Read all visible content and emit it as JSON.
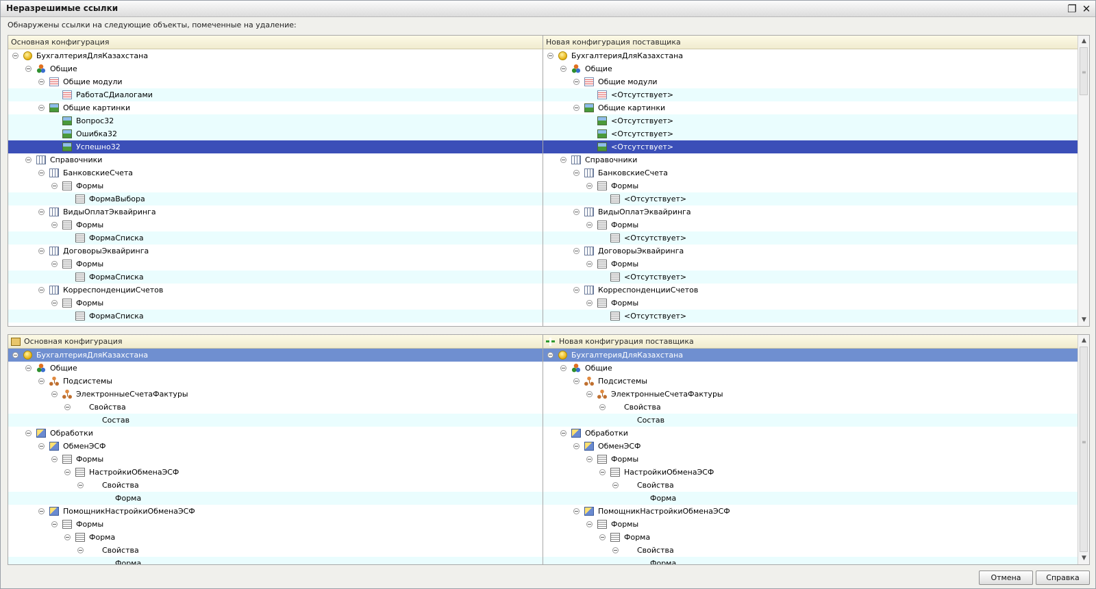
{
  "window": {
    "title": "Неразрешимые ссылки",
    "restore_icon": "restore-window-icon",
    "close_icon": "close-icon"
  },
  "description": "Обнаружены ссылки на следующие объекты, помеченные на удаление:",
  "top_panel": {
    "left_header": "Основная конфигурация",
    "right_header": "Новая конфигурация поставщика",
    "rows": [
      {
        "level": 0,
        "icon": "config",
        "left": "БухгалтерияДляКазахстана",
        "right": "БухгалтерияДляКазахстана",
        "expander": true,
        "alt": false,
        "selected": false
      },
      {
        "level": 1,
        "icon": "common",
        "left": "Общие",
        "right": "Общие",
        "expander": true,
        "alt": false,
        "selected": false
      },
      {
        "level": 2,
        "icon": "module",
        "left": "Общие модули",
        "right": "Общие модули",
        "expander": true,
        "alt": false,
        "selected": false
      },
      {
        "level": 3,
        "icon": "module",
        "left": "РаботаСДиалогами",
        "right": "<Отсутствует>",
        "expander": false,
        "alt": true,
        "selected": false
      },
      {
        "level": 2,
        "icon": "picture",
        "left": "Общие картинки",
        "right": "Общие картинки",
        "expander": true,
        "alt": false,
        "selected": false
      },
      {
        "level": 3,
        "icon": "picture",
        "left": "Вопрос32",
        "right": "<Отсутствует>",
        "expander": false,
        "alt": true,
        "selected": false
      },
      {
        "level": 3,
        "icon": "picture",
        "left": "Ошибка32",
        "right": "<Отсутствует>",
        "expander": false,
        "alt": true,
        "selected": false
      },
      {
        "level": 3,
        "icon": "picture",
        "left": "Успешно32",
        "right": "<Отсутствует>",
        "expander": false,
        "alt": false,
        "selected": true
      },
      {
        "level": 1,
        "icon": "catalog",
        "left": "Справочники",
        "right": "Справочники",
        "expander": true,
        "alt": false,
        "selected": false
      },
      {
        "level": 2,
        "icon": "catalog",
        "left": "БанковскиеСчета",
        "right": "БанковскиеСчета",
        "expander": true,
        "alt": false,
        "selected": false
      },
      {
        "level": 3,
        "icon": "form",
        "left": "Формы",
        "right": "Формы",
        "expander": true,
        "alt": false,
        "selected": false
      },
      {
        "level": 4,
        "icon": "form",
        "left": "ФормаВыбора",
        "right": "<Отсутствует>",
        "expander": false,
        "alt": true,
        "selected": false
      },
      {
        "level": 2,
        "icon": "catalog",
        "left": "ВидыОплатЭквайринга",
        "right": "ВидыОплатЭквайринга",
        "expander": true,
        "alt": false,
        "selected": false
      },
      {
        "level": 3,
        "icon": "form",
        "left": "Формы",
        "right": "Формы",
        "expander": true,
        "alt": false,
        "selected": false
      },
      {
        "level": 4,
        "icon": "form",
        "left": "ФормаСписка",
        "right": "<Отсутствует>",
        "expander": false,
        "alt": true,
        "selected": false
      },
      {
        "level": 2,
        "icon": "catalog",
        "left": "ДоговорыЭквайринга",
        "right": "ДоговорыЭквайринга",
        "expander": true,
        "alt": false,
        "selected": false
      },
      {
        "level": 3,
        "icon": "form",
        "left": "Формы",
        "right": "Формы",
        "expander": true,
        "alt": false,
        "selected": false
      },
      {
        "level": 4,
        "icon": "form",
        "left": "ФормаСписка",
        "right": "<Отсутствует>",
        "expander": false,
        "alt": true,
        "selected": false
      },
      {
        "level": 2,
        "icon": "catalog",
        "left": "КорреспонденцииСчетов",
        "right": "КорреспонденцииСчетов",
        "expander": true,
        "alt": false,
        "selected": false
      },
      {
        "level": 3,
        "icon": "form",
        "left": "Формы",
        "right": "Формы",
        "expander": true,
        "alt": false,
        "selected": false
      },
      {
        "level": 4,
        "icon": "form",
        "left": "ФормаСписка",
        "right": "<Отсутствует>",
        "expander": false,
        "alt": true,
        "selected": false
      }
    ]
  },
  "bottom_panel": {
    "left_header": "Основная конфигурация",
    "right_header": "Новая конфигурация поставщика",
    "rows": [
      {
        "level": 0,
        "icon": "config",
        "left": "БухгалтерияДляКазахстана",
        "right": "БухгалтерияДляКазахстана",
        "expander": true,
        "alt": false,
        "selected": true
      },
      {
        "level": 1,
        "icon": "common",
        "left": "Общие",
        "right": "Общие",
        "expander": true,
        "alt": false,
        "selected": false
      },
      {
        "level": 2,
        "icon": "subsystem",
        "left": "Подсистемы",
        "right": "Подсистемы",
        "expander": true,
        "alt": false,
        "selected": false
      },
      {
        "level": 3,
        "icon": "subsystem",
        "left": "ЭлектронныеСчетаФактуры",
        "right": "ЭлектронныеСчетаФактуры",
        "expander": true,
        "alt": false,
        "selected": false
      },
      {
        "level": 4,
        "icon": "none",
        "left": "Свойства",
        "right": "Свойства",
        "expander": true,
        "alt": false,
        "selected": false
      },
      {
        "level": 5,
        "icon": "none",
        "left": "Состав",
        "right": "Состав",
        "expander": false,
        "alt": true,
        "selected": false
      },
      {
        "level": 1,
        "icon": "processing",
        "left": "Обработки",
        "right": "Обработки",
        "expander": true,
        "alt": false,
        "selected": false
      },
      {
        "level": 2,
        "icon": "processing",
        "left": "ОбменЭСФ",
        "right": "ОбменЭСФ",
        "expander": true,
        "alt": false,
        "selected": false
      },
      {
        "level": 3,
        "icon": "form",
        "left": "Формы",
        "right": "Формы",
        "expander": true,
        "alt": false,
        "selected": false
      },
      {
        "level": 4,
        "icon": "form",
        "left": "НастройкиОбменаЭСФ",
        "right": "НастройкиОбменаЭСФ",
        "expander": true,
        "alt": false,
        "selected": false
      },
      {
        "level": 5,
        "icon": "none",
        "left": "Свойства",
        "right": "Свойства",
        "expander": true,
        "alt": false,
        "selected": false
      },
      {
        "level": 6,
        "icon": "none",
        "left": "Форма",
        "right": "Форма",
        "expander": false,
        "alt": true,
        "selected": false
      },
      {
        "level": 2,
        "icon": "processing",
        "left": "ПомощникНастройкиОбменаЭСФ",
        "right": "ПомощникНастройкиОбменаЭСФ",
        "expander": true,
        "alt": false,
        "selected": false
      },
      {
        "level": 3,
        "icon": "form",
        "left": "Формы",
        "right": "Формы",
        "expander": true,
        "alt": false,
        "selected": false
      },
      {
        "level": 4,
        "icon": "form",
        "left": "Форма",
        "right": "Форма",
        "expander": true,
        "alt": false,
        "selected": false
      },
      {
        "level": 5,
        "icon": "none",
        "left": "Свойства",
        "right": "Свойства",
        "expander": true,
        "alt": false,
        "selected": false
      },
      {
        "level": 6,
        "icon": "none",
        "left": "Форма",
        "right": "Форма",
        "expander": false,
        "alt": true,
        "selected": false
      }
    ]
  },
  "buttons": {
    "cancel": "Отмена",
    "help": "Справка"
  }
}
